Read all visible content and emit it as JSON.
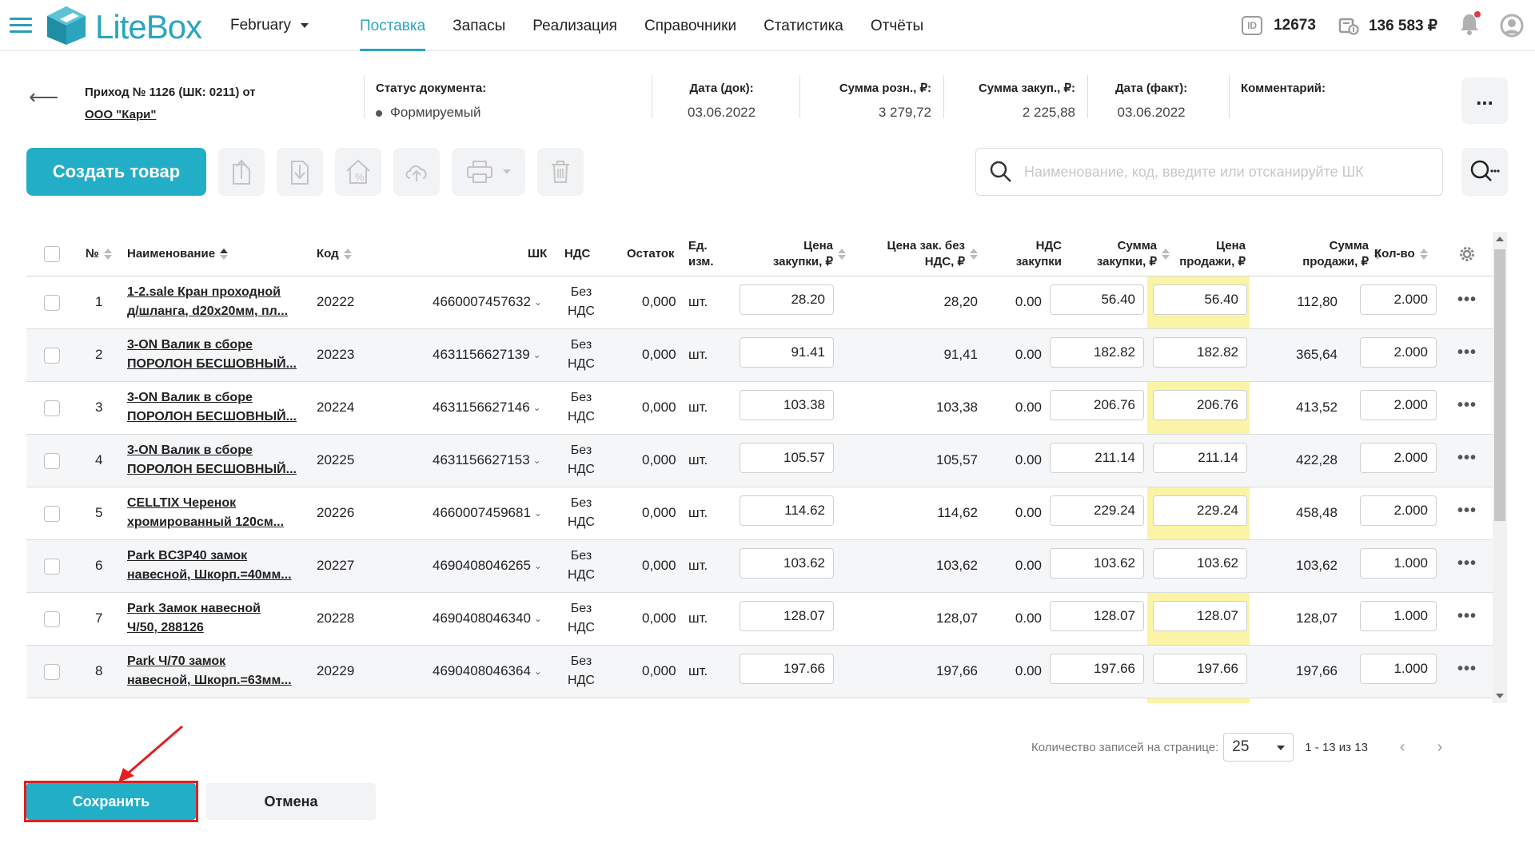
{
  "app": {
    "logo": "LiteBox",
    "month": "February"
  },
  "nav": [
    "Поставка",
    "Запасы",
    "Реализация",
    "Справочники",
    "Статистика",
    "Отчёты"
  ],
  "topright": {
    "id_label": "ID",
    "id_value": "12673",
    "balance": "136 583 ₽"
  },
  "doc": {
    "title_prefix": "Приход № 1126 (ШК: 0211) от",
    "supplier": "ООО \"Кари\"",
    "status_label": "Статус документа:",
    "status_value": "Формируемый",
    "date_doc_label": "Дата (док):",
    "date_doc": "03.06.2022",
    "sum_retail_label": "Сумма розн., ₽:",
    "sum_retail": "3 279,72",
    "sum_purchase_label": "Сумма закуп., ₽:",
    "sum_purchase": "2 225,88",
    "date_fact_label": "Дата (факт):",
    "date_fact": "03.06.2022",
    "comment_label": "Комментарий:",
    "more": "..."
  },
  "toolbar": {
    "create_label": "Создать товар",
    "search_placeholder": "Наименование, код, введите или отсканируйте ШК"
  },
  "table": {
    "headers": {
      "num": "№",
      "name": "Наименование",
      "code": "Код",
      "barcode": "ШК",
      "nds": "НДС",
      "stock": "Остаток",
      "unit1": "Ед.",
      "unit2": "изм.",
      "purchase_price1": "Цена",
      "purchase_price2": "закупки, ₽",
      "price_no_vat1": "Цена зак. без",
      "price_no_vat2": "НДС, ₽",
      "vat_purchase1": "НДС",
      "vat_purchase2": "закупки",
      "purchase_sum1": "Сумма",
      "purchase_sum2": "закупки, ₽",
      "sale_price1": "Цена",
      "sale_price2": "продажи, ₽",
      "sale_sum1": "Сумма",
      "sale_sum2": "продажи, ₽",
      "qty": "Кол-во"
    },
    "rows": [
      {
        "num": "1",
        "name1": "1-2.sale Кран проходной",
        "name2": "д/шланга, d20x20мм, пл...",
        "code": "20222",
        "barcode": "4660007457632",
        "nds1": "Без",
        "nds2": "НДС",
        "stock": "0,000",
        "unit": "шт.",
        "purchase_price": "28.20",
        "price_no_vat": "28,20",
        "vat": "0.00",
        "purchase_sum": "56.40",
        "sale_price": "56.40",
        "sale_sum": "112,80",
        "qty": "2.000"
      },
      {
        "num": "2",
        "name1": "3-ON Валик в сборе",
        "name2": "ПОРОЛОН БЕСШОВНЫЙ...",
        "code": "20223",
        "barcode": "4631156627139",
        "nds1": "Без",
        "nds2": "НДС",
        "stock": "0,000",
        "unit": "шт.",
        "purchase_price": "91.41",
        "price_no_vat": "91,41",
        "vat": "0.00",
        "purchase_sum": "182.82",
        "sale_price": "182.82",
        "sale_sum": "365,64",
        "qty": "2.000"
      },
      {
        "num": "3",
        "name1": "3-ON Валик в сборе",
        "name2": "ПОРОЛОН БЕСШОВНЫЙ...",
        "code": "20224",
        "barcode": "4631156627146",
        "nds1": "Без",
        "nds2": "НДС",
        "stock": "0,000",
        "unit": "шт.",
        "purchase_price": "103.38",
        "price_no_vat": "103,38",
        "vat": "0.00",
        "purchase_sum": "206.76",
        "sale_price": "206.76",
        "sale_sum": "413,52",
        "qty": "2.000"
      },
      {
        "num": "4",
        "name1": "3-ON Валик в сборе",
        "name2": "ПОРОЛОН БЕСШОВНЫЙ...",
        "code": "20225",
        "barcode": "4631156627153",
        "nds1": "Без",
        "nds2": "НДС",
        "stock": "0,000",
        "unit": "шт.",
        "purchase_price": "105.57",
        "price_no_vat": "105,57",
        "vat": "0.00",
        "purchase_sum": "211.14",
        "sale_price": "211.14",
        "sale_sum": "422,28",
        "qty": "2.000"
      },
      {
        "num": "5",
        "name1": "CELLTIX Черенок",
        "name2": "хромированный 120см...",
        "code": "20226",
        "barcode": "4660007459681",
        "nds1": "Без",
        "nds2": "НДС",
        "stock": "0,000",
        "unit": "шт.",
        "purchase_price": "114.62",
        "price_no_vat": "114,62",
        "vat": "0.00",
        "purchase_sum": "229.24",
        "sale_price": "229.24",
        "sale_sum": "458,48",
        "qty": "2.000"
      },
      {
        "num": "6",
        "name1": "Park BC3P40 замок",
        "name2": "навесной, Шкорп.=40мм...",
        "code": "20227",
        "barcode": "4690408046265",
        "nds1": "Без",
        "nds2": "НДС",
        "stock": "0,000",
        "unit": "шт.",
        "purchase_price": "103.62",
        "price_no_vat": "103,62",
        "vat": "0.00",
        "purchase_sum": "103.62",
        "sale_price": "103.62",
        "sale_sum": "103,62",
        "qty": "1.000"
      },
      {
        "num": "7",
        "name1": "Park Замок навесной",
        "name2": "Ч/50, 288126",
        "code": "20228",
        "barcode": "4690408046340",
        "nds1": "Без",
        "nds2": "НДС",
        "stock": "0,000",
        "unit": "шт.",
        "purchase_price": "128.07",
        "price_no_vat": "128,07",
        "vat": "0.00",
        "purchase_sum": "128.07",
        "sale_price": "128.07",
        "sale_sum": "128,07",
        "qty": "1.000"
      },
      {
        "num": "8",
        "name1": "Park Ч/70 замок",
        "name2": "навесной, Шкорп.=63мм...",
        "code": "20229",
        "barcode": "4690408046364",
        "nds1": "Без",
        "nds2": "НДС",
        "stock": "0,000",
        "unit": "шт.",
        "purchase_price": "197.66",
        "price_no_vat": "197,66",
        "vat": "0.00",
        "purchase_sum": "197.66",
        "sale_price": "197.66",
        "sale_sum": "197,66",
        "qty": "1.000"
      }
    ]
  },
  "pager": {
    "label": "Количество записей на странице:",
    "per_page": "25",
    "range": "1 - 13 из 13"
  },
  "actions": {
    "save": "Сохранить",
    "cancel": "Отмена"
  },
  "colors": {
    "accent": "#22aec6",
    "highlight": "#fbf3a6",
    "annotation": "#e02020"
  }
}
